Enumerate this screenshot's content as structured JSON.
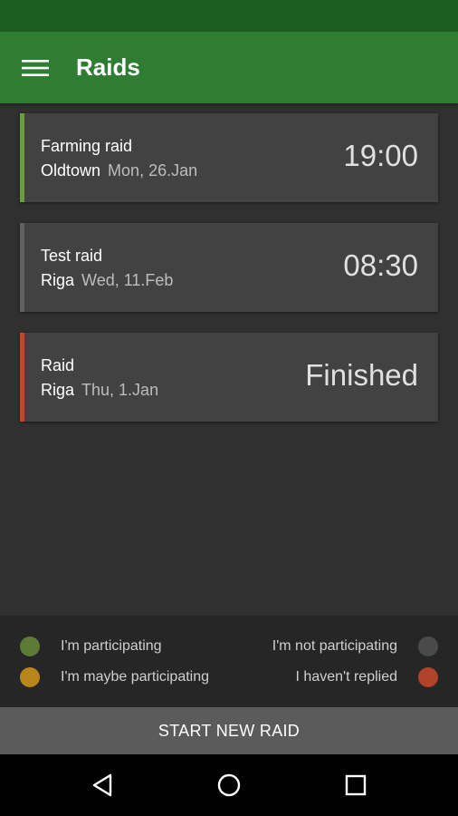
{
  "app_bar": {
    "title": "Raids",
    "menu_icon": "hamburger-menu-icon",
    "background": "#2e7d32"
  },
  "raids": [
    {
      "name": "Farming raid",
      "location": "Oldtown",
      "date": "Mon, 26.Jan",
      "time": "19:00",
      "status_color": "#689f38"
    },
    {
      "name": "Test raid",
      "location": "Riga",
      "date": "Wed, 11.Feb",
      "time": "08:30",
      "status_color": "#616161"
    },
    {
      "name": "Raid",
      "location": "Riga",
      "date": "Thu, 1.Jan",
      "time": "Finished",
      "status_color": "#bf4a2a"
    }
  ],
  "legend": {
    "participating": {
      "label": "I'm participating",
      "color": "#5d7a36"
    },
    "maybe": {
      "label": "I'm maybe participating",
      "color": "#b8861b"
    },
    "not_participating": {
      "label": "I'm not participating",
      "color": "#4a4a4a"
    },
    "not_replied": {
      "label": "I haven't replied",
      "color": "#b0432a"
    }
  },
  "actions": {
    "start_new_raid": "START NEW RAID"
  },
  "nav": {
    "back": "back-triangle-icon",
    "home": "home-circle-icon",
    "recents": "recents-square-icon"
  }
}
